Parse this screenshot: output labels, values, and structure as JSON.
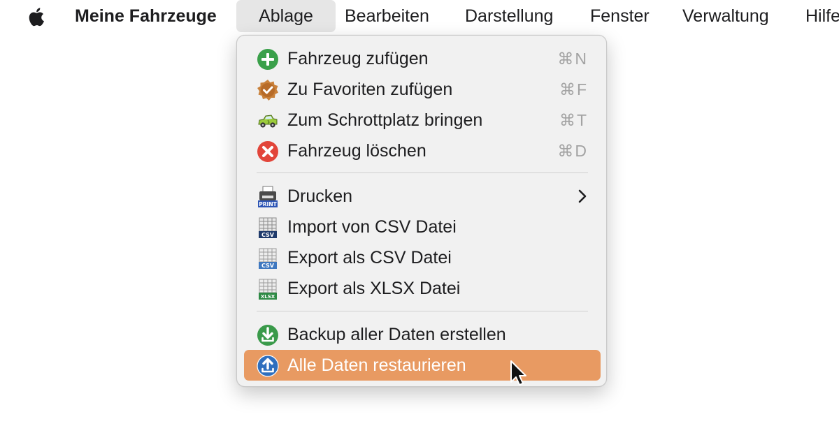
{
  "menubar": {
    "apple_icon": "apple-logo-icon",
    "app_name": "Meine Fahrzeuge",
    "items": [
      "Ablage",
      "Bearbeiten",
      "Darstellung",
      "Fenster",
      "Verwaltung",
      "Hilfe"
    ]
  },
  "menu": {
    "group1": [
      {
        "label": "Fahrzeug zufügen",
        "shortcut": "⌘N",
        "icon": "add-circle-icon"
      },
      {
        "label": "Zu Favoriten zufügen",
        "shortcut": "⌘F",
        "icon": "favorite-badge-icon"
      },
      {
        "label": "Zum Schrottplatz bringen",
        "shortcut": "⌘T",
        "icon": "scrap-car-icon"
      },
      {
        "label": "Fahrzeug löschen",
        "shortcut": "⌘D",
        "icon": "delete-circle-icon"
      }
    ],
    "group2": [
      {
        "label": "Drucken",
        "icon": "print-icon",
        "submenu": true
      },
      {
        "label": "Import von CSV Datei",
        "icon": "csv-import-icon",
        "badge": "CSV"
      },
      {
        "label": "Export als CSV Datei",
        "icon": "csv-export-icon",
        "badge": "CSV"
      },
      {
        "label": "Export als XLSX Datei",
        "icon": "xlsx-export-icon",
        "badge": "XLSX"
      }
    ],
    "group3": [
      {
        "label": "Backup aller Daten erstellen",
        "icon": "download-circle-icon"
      },
      {
        "label": "Alle Daten restaurieren",
        "icon": "upload-circle-icon",
        "highlighted": true
      }
    ],
    "print_badge": "PRINT"
  },
  "colors": {
    "highlight": "#e89a62",
    "menu_background": "#f1f1f1",
    "active_menubar_item": "#e6e6e6"
  }
}
